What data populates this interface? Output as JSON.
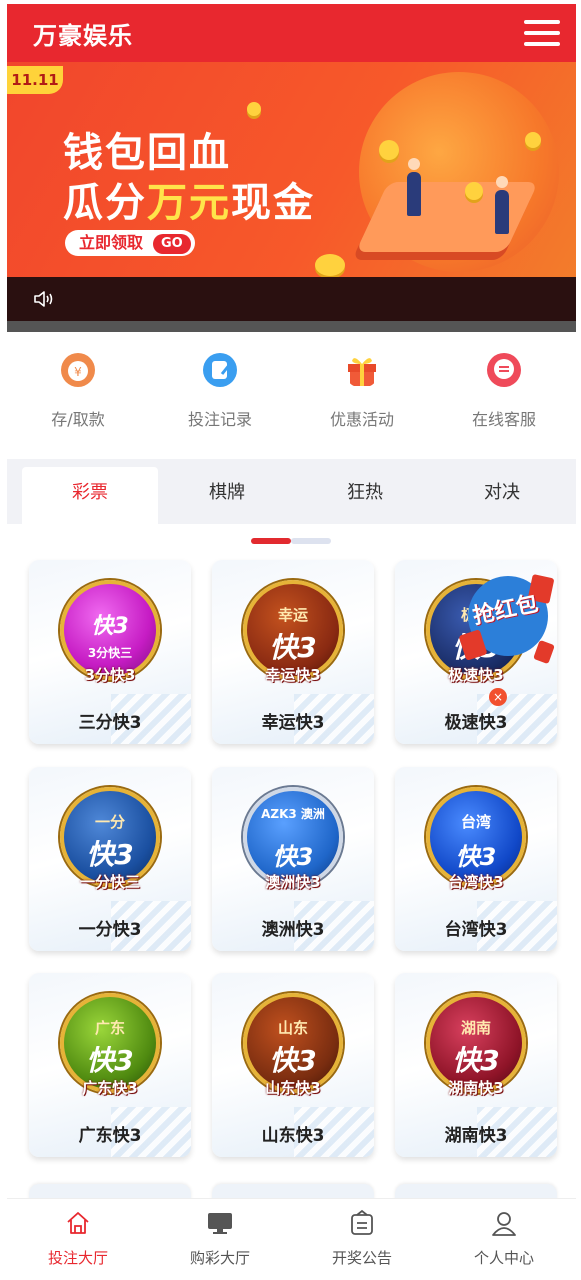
{
  "header": {
    "brand": "万豪娱乐",
    "menu_icon": "hamburger-menu-icon"
  },
  "banner": {
    "badge": "11.11",
    "line1": "钱包回血",
    "line2_prefix": "瓜分",
    "line2_highlight": "万元",
    "line2_suffix": "现金",
    "button_label": "立即领取",
    "button_go": "GO",
    "sound_icon": "speaker-icon"
  },
  "quick_actions": [
    {
      "label": "存/取款",
      "icon": "deposit-icon",
      "color": "#f08a4b"
    },
    {
      "label": "投注记录",
      "icon": "record-icon",
      "color": "#3a9ef0"
    },
    {
      "label": "优惠活动",
      "icon": "gift-icon",
      "color": "#e84a2a"
    },
    {
      "label": "在线客服",
      "icon": "chat-icon",
      "color": "#ef4a5a"
    }
  ],
  "tabs": [
    {
      "label": "彩票",
      "active": true
    },
    {
      "label": "棋牌",
      "active": false
    },
    {
      "label": "狂热",
      "active": false
    },
    {
      "label": "对决",
      "active": false
    }
  ],
  "games": [
    {
      "name": "三分快3",
      "top": "",
      "main": "快3",
      "cap": "3分快3",
      "sub": "3分快三",
      "color": "#c61cc4"
    },
    {
      "name": "幸运快3",
      "top": "幸运",
      "main": "快3",
      "cap": "幸运快3",
      "sub": "",
      "color": "#8a2a12"
    },
    {
      "name": "极速快3",
      "top": "极速",
      "main": "快3",
      "cap": "极速快3",
      "sub": "",
      "color": "#1b2f6a"
    },
    {
      "name": "一分快3",
      "top": "一分",
      "main": "快3",
      "cap": "一分快三",
      "sub": "",
      "color": "#1a4fa0"
    },
    {
      "name": "澳洲快3",
      "top": "AZK3 澳洲",
      "main": "快3",
      "cap": "澳洲快3",
      "sub": "",
      "color": "#1f66c9"
    },
    {
      "name": "台湾快3",
      "top": "台湾",
      "main": "快3",
      "cap": "台湾快3",
      "sub": "",
      "color": "#1148c8"
    },
    {
      "name": "广东快3",
      "top": "广东",
      "main": "快3",
      "cap": "广东快3",
      "sub": "",
      "color": "#4f8a10"
    },
    {
      "name": "山东快3",
      "top": "山东",
      "main": "快3",
      "cap": "山东快3",
      "sub": "",
      "color": "#7a2d10"
    },
    {
      "name": "湖南快3",
      "top": "湖南",
      "main": "快3",
      "cap": "湖南快3",
      "sub": "",
      "color": "#8f1428"
    }
  ],
  "promo": {
    "text": "抢红包",
    "close": "×"
  },
  "bottom_nav": [
    {
      "label": "投注大厅",
      "icon": "home-icon",
      "active": true
    },
    {
      "label": "购彩大厅",
      "icon": "monitor-icon",
      "active": false
    },
    {
      "label": "开奖公告",
      "icon": "bulletin-icon",
      "active": false
    },
    {
      "label": "个人中心",
      "icon": "user-icon",
      "active": false
    }
  ],
  "colors": {
    "primary": "#e8282f",
    "tab_bg": "#f1f2f6"
  }
}
